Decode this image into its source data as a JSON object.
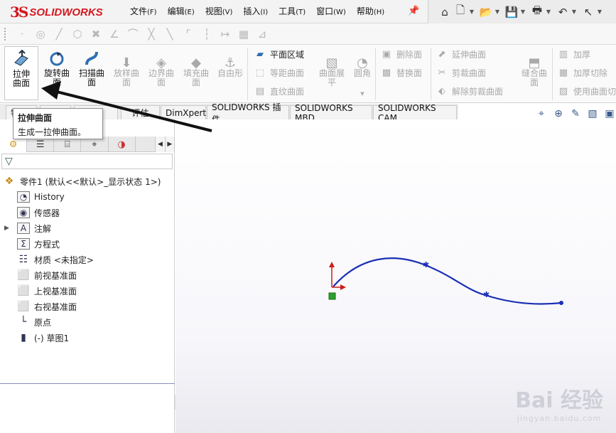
{
  "app": {
    "brand_ds": "3S",
    "brand_name": "SOLIDWORKS"
  },
  "menu": [
    {
      "label": "文件",
      "acc": "(F)"
    },
    {
      "label": "编辑",
      "acc": "(E)"
    },
    {
      "label": "视图",
      "acc": "(V)"
    },
    {
      "label": "插入",
      "acc": "(I)"
    },
    {
      "label": "工具",
      "acc": "(T)"
    },
    {
      "label": "窗口",
      "acc": "(W)"
    },
    {
      "label": "帮助",
      "acc": "(H)"
    }
  ],
  "ribbon": {
    "extrude_surface": "拉伸曲面",
    "revolve_surface": "旋转曲面",
    "sweep_surface": "扫描曲面",
    "loft_surface": "放样曲面",
    "boundary_surface": "边界曲面",
    "fill_surface": "填充曲面",
    "freeform": "自由形",
    "planar_surface": "平面区域",
    "offset_surface": "等距曲面",
    "ruled_surface": "直纹曲面",
    "flatten_surface": "曲面展平",
    "fillet": "圆角",
    "delete_face": "删除面",
    "replace_face": "替换面",
    "extend_surface": "延伸曲面",
    "trim_surface": "剪裁曲面",
    "untrim_surface": "解除剪裁曲面",
    "knit_surface": "缝合曲面",
    "thicken": "加厚",
    "thicken_cut": "加厚切除",
    "cut_with_surface": "使用曲面切"
  },
  "tabs": {
    "features": "特征",
    "sketch": "草图",
    "surfaces": "曲面",
    "evaluate": "评估",
    "dimxpert": "DimXpert",
    "addins": "SOLIDWORKS 插件",
    "mbd": "SOLIDWORKS MBD",
    "cam": "SOLIDWORKS CAM"
  },
  "tooltip": {
    "title": "拉伸曲面",
    "description": "生成一拉伸曲面。"
  },
  "tree": {
    "root": "零件1 (默认<<默认>_显示状态 1>)",
    "items": [
      {
        "label": "History"
      },
      {
        "label": "传感器"
      },
      {
        "label": "注解"
      },
      {
        "label": "方程式"
      },
      {
        "label": "材质 <未指定>"
      },
      {
        "label": "前视基准面"
      },
      {
        "label": "上视基准面"
      },
      {
        "label": "右视基准面"
      },
      {
        "label": "原点"
      },
      {
        "label": "(-) 草图1"
      }
    ]
  },
  "watermark": {
    "main": "Bai 经验",
    "sub": "jingyan.baidu.com"
  },
  "colors": {
    "curve": "#1a2fb5",
    "brand": "#d4171e",
    "axis_y": "#d11a1a",
    "origin": "#2ca02c"
  }
}
